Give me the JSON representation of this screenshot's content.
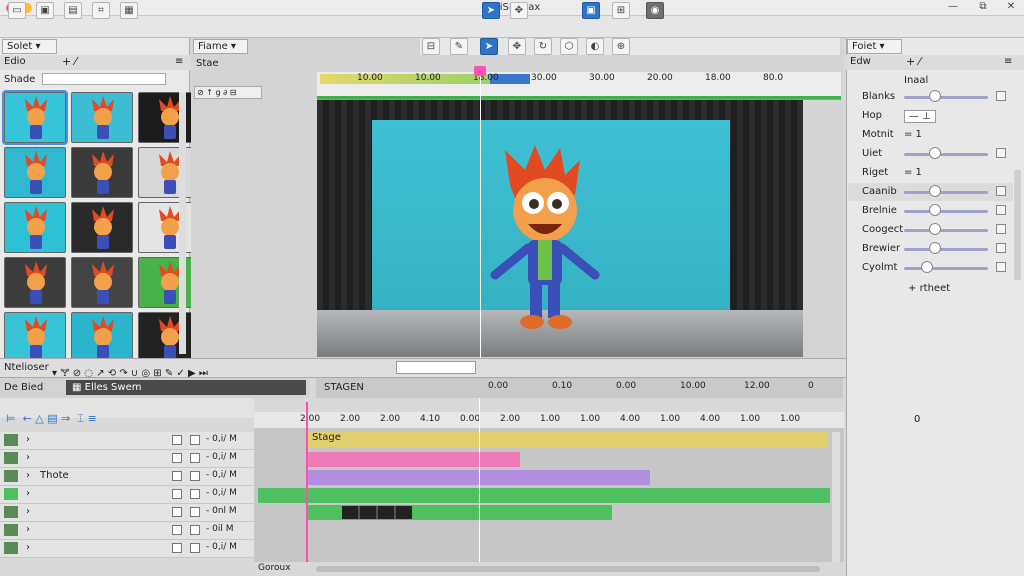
{
  "window": {
    "title": "SWiSH Max",
    "minimize": "—",
    "maximize": "⧉",
    "close": "✕"
  },
  "colors": {
    "accent": "#2f74c8",
    "playhead": "#ff4fb4",
    "stage_bar": "#e2cf6e",
    "pink_bar": "#f07ab8",
    "purple_bar": "#b28ee0",
    "green_bar": "#4fc060"
  },
  "left_panel": {
    "tab": "Solet",
    "subtab": "Edio",
    "filter_label": "Shade",
    "thumb_count": 15
  },
  "frame_panel": {
    "tab": "Fiame",
    "label": "Stae"
  },
  "ruler": {
    "ticks": [
      "10.00",
      "10.00",
      "18.00",
      "30.00",
      "30.00",
      "20.00",
      "18.00",
      "80.0"
    ]
  },
  "right_panel": {
    "tab": "Foiet",
    "subtab": "Edw",
    "header": "Inaal",
    "props": [
      {
        "label": "Blanks",
        "kind": "slider",
        "value": 0.3
      },
      {
        "label": "Hop",
        "kind": "input",
        "value": "— ⊥"
      },
      {
        "label": "Motnit",
        "kind": "value",
        "value": "= 1"
      },
      {
        "label": "Uiet",
        "kind": "slider",
        "value": 0.3
      },
      {
        "label": "Riget",
        "kind": "value",
        "value": "= 1"
      },
      {
        "label": "Caanib",
        "kind": "slider",
        "value": 0.3
      },
      {
        "label": "Brelnie",
        "kind": "slider",
        "value": 0.3
      },
      {
        "label": "Coogect",
        "kind": "slider",
        "value": 0.3
      },
      {
        "label": "Brewier",
        "kind": "slider",
        "value": 0.3
      },
      {
        "label": "Cyolmt",
        "kind": "slider",
        "value": 0.2
      }
    ],
    "footer": "rtheet",
    "misc_value": "0"
  },
  "timeline": {
    "panel_label": "Ntelioser",
    "layer_label": "De Bied",
    "scene_label": "Elles Swem",
    "stage_label": "STAGEN",
    "top_ruler": [
      "0.00",
      "0.10",
      "0.00",
      "10.00",
      "12.00",
      "0"
    ],
    "ruler": [
      "2.00",
      "2.00",
      "2.00",
      "4.10",
      "0.00",
      "2.00",
      "1.00",
      "1.00",
      "4.00",
      "1.00",
      "4.00",
      "1.00",
      "1.00"
    ],
    "rows": [
      {
        "name": "",
        "value": "0,i/ M"
      },
      {
        "name": "",
        "value": "0,i/ M"
      },
      {
        "name": "Thote",
        "value": "0,i/ M"
      },
      {
        "name": "",
        "value": "0,i/ M"
      },
      {
        "name": "",
        "value": "0nl M"
      },
      {
        "name": "",
        "value": "0il M"
      },
      {
        "name": "",
        "value": "0,i/ M"
      }
    ],
    "stage_bar_label": "Stage",
    "status_label": "Goroux"
  }
}
